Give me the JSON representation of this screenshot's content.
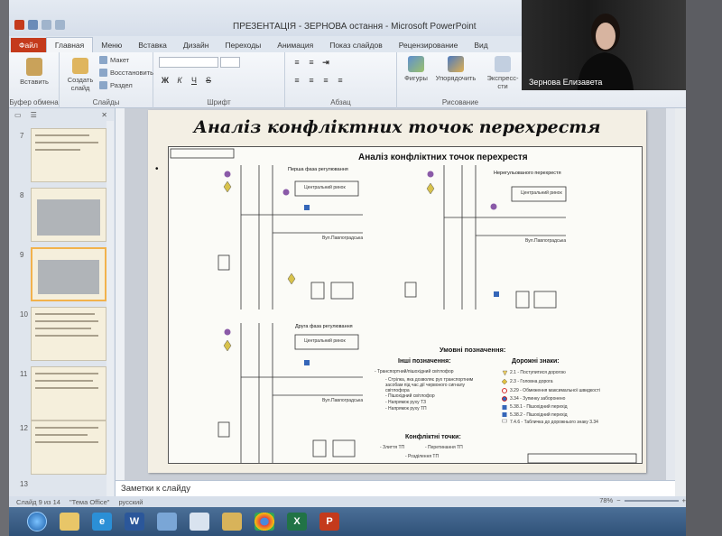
{
  "window": {
    "title": "ПРЕЗЕНТАЦІЯ - ЗЕРНОВА остання  -  Microsoft PowerPoint"
  },
  "tabs": [
    {
      "label": "Файл"
    },
    {
      "label": "Главная"
    },
    {
      "label": "Меню"
    },
    {
      "label": "Вставка"
    },
    {
      "label": "Дизайн"
    },
    {
      "label": "Переходы"
    },
    {
      "label": "Анимация"
    },
    {
      "label": "Показ слайдов"
    },
    {
      "label": "Рецензирование"
    },
    {
      "label": "Вид"
    }
  ],
  "ribbon": {
    "paste": "Вставить",
    "new_slide": "Создать слайд",
    "layout": "Макет",
    "reset": "Восстановить",
    "section": "Раздел",
    "clipboard_group": "Буфер обмена",
    "slides_group": "Слайды",
    "font_group": "Шрифт",
    "paragraph_group": "Абзац",
    "shapes": "Фигуры",
    "arrange": "Упорядочить",
    "quick_styles": "Экспресс-сти",
    "drawing_group": "Рисование"
  },
  "webcam": {
    "name": "Зернова Елизавета"
  },
  "slides_pane": {
    "tab_slides": "Слайды",
    "tab_outline": "Структура",
    "slides": [
      {
        "number": "7",
        "title": "Аналіз"
      },
      {
        "number": "8",
        "title": ""
      },
      {
        "number": "9",
        "title": ""
      },
      {
        "number": "10",
        "title": "Аналіз регулювання перехрестя"
      },
      {
        "number": "11",
        "title": ""
      },
      {
        "number": "12",
        "title": ""
      },
      {
        "number": "13",
        "title": ""
      }
    ]
  },
  "slide": {
    "title": "Аналіз конфліктних точок перехрестя",
    "bullet": "•",
    "drawing": {
      "heading": "Аналіз конфліктних точок перехрестя",
      "phase1": "Перша фаза регулювання",
      "phase2": "Друга фаза регулювання",
      "unregulated": "Нерегульованого перехрестя",
      "central_market": "Центральний ринок",
      "street": "Вул.Павлоградська",
      "legend_title": "Умовні позначення:",
      "other_title": "Інші позначення:",
      "road_signs_title": "Дорожні знаки:",
      "conflict_title": "Конфліктні точки:",
      "other_items": [
        "- Транспортний/пішохідний світлофор",
        "- Стрілка, яка дозволяє рух транспортним засобам під час дії червоного сигналу світлофора",
        "- Пішохідний світлофор",
        "- Напрямок руху ТЗ",
        "- Напрямок руху ТП"
      ],
      "sign_items": [
        "2.1 - Поступитися дорогою",
        "2.3 - Головна дорога",
        "3.29 - Обмеження максимальної швидкості",
        "3.34 - Зупинку заборонено",
        "5.38.1 - Пішохідний перехід",
        "5.38.2 - Пішохідний перехід",
        "7.4.6 - Табличка до дорожнього знаку 3.34"
      ],
      "conflict_items": [
        "- Злиття ТП",
        "- Перетинання ТП",
        "- Розділення ТП"
      ]
    }
  },
  "notes": {
    "placeholder": "Заметки к слайду"
  },
  "status": {
    "slide_of": "Слайд 9 из 14",
    "theme": "\"Тема Office\"",
    "language": "русский",
    "zoom": "78%"
  },
  "taskbar": {
    "apps": [
      "explorer",
      "edge",
      "word",
      "files",
      "notepad",
      "paint",
      "chrome",
      "excel",
      "powerpoint"
    ]
  },
  "colors": {
    "file_tab": "#c43a1c",
    "slide_bg": "#f3efe4",
    "taskbar": "#2f5178"
  }
}
